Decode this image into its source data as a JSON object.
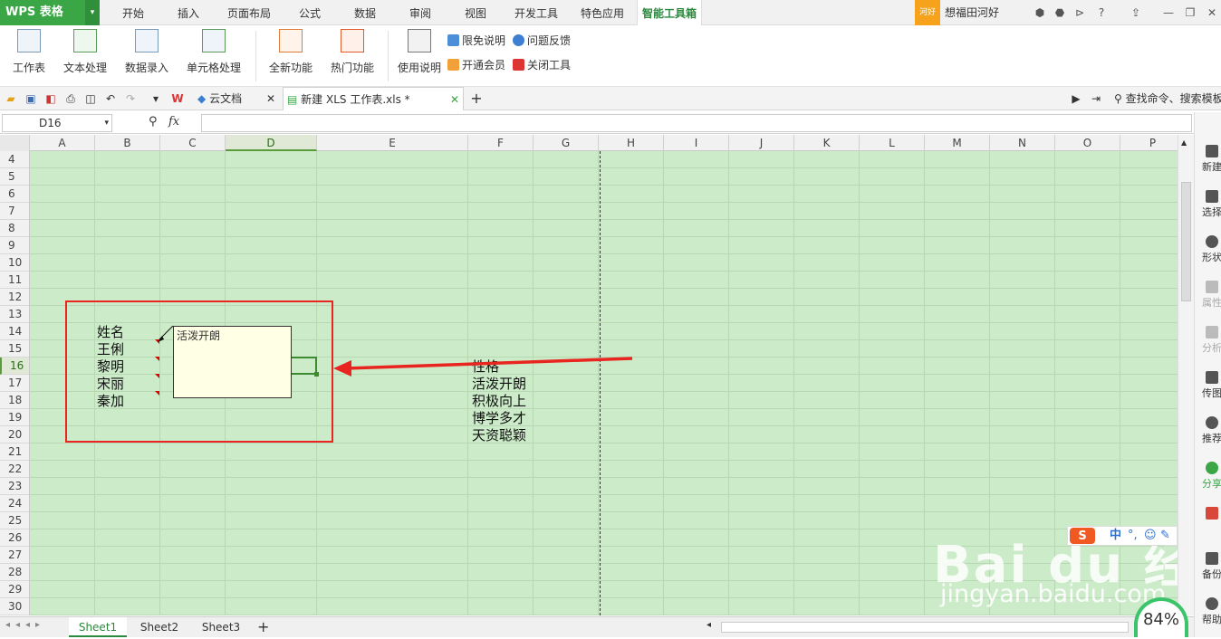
{
  "app": {
    "logo": "WPS 表格",
    "logo_arrow": "▾"
  },
  "menu": [
    "开始",
    "插入",
    "页面布局",
    "公式",
    "数据",
    "审阅",
    "视图",
    "开发工具",
    "特色应用",
    "智能工具箱"
  ],
  "user": {
    "badge": "河好",
    "name": "想福田河好"
  },
  "ribbon": {
    "buttons": [
      "工作表",
      "文本处理",
      "数据录入",
      "单元格处理",
      "全新功能",
      "热门功能",
      "使用说明"
    ],
    "small": [
      "限免说明",
      "问题反馈",
      "开通会员",
      "关闭工具"
    ]
  },
  "tabs": {
    "cloud": "云文档",
    "file": "新建 XLS 工作表.xls *"
  },
  "search_placeholder": "查找命令、搜索模板",
  "namebox": "D16",
  "fx": "fx",
  "columns": [
    "A",
    "B",
    "C",
    "D",
    "E",
    "F",
    "G",
    "H",
    "I",
    "J",
    "K",
    "L",
    "M",
    "N",
    "O",
    "P"
  ],
  "rows": [
    "4",
    "5",
    "6",
    "7",
    "8",
    "9",
    "10",
    "11",
    "12",
    "13",
    "14",
    "15",
    "16",
    "17",
    "18",
    "19",
    "20",
    "21",
    "22",
    "23",
    "24",
    "25",
    "26",
    "27",
    "28",
    "29",
    "30"
  ],
  "cells_b": [
    "姓名",
    "王俐",
    "黎明",
    "宋丽",
    "秦加"
  ],
  "comment": "活泼开朗",
  "cells_f": [
    "性格",
    "活泼开朗",
    "积极向上",
    "博学多才",
    "天资聪颖"
  ],
  "sheets": [
    "Sheet1",
    "Sheet2",
    "Sheet3"
  ],
  "right_panel": [
    "新建",
    "选择",
    "形状",
    "属性",
    "分析",
    "传图",
    "推荐",
    "分享",
    "",
    "备份",
    "帮助"
  ],
  "watermark": {
    "main": "Bai du 经验",
    "sub": "jingyan.baidu.com"
  },
  "speed": "84%",
  "ime": [
    "中"
  ]
}
